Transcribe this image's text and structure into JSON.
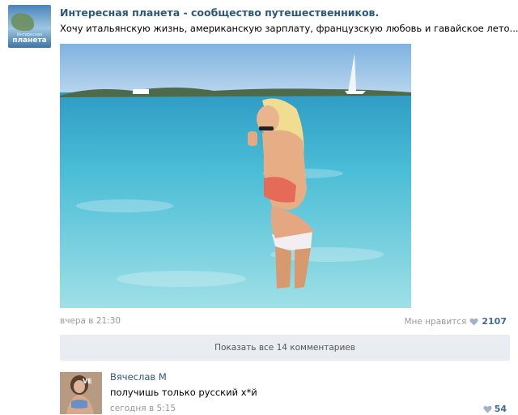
{
  "group": {
    "name": "Интересная планета - сообщество путешественников.",
    "avatar_text": "планета",
    "avatar_small_text": "Интересная"
  },
  "post": {
    "text": "Хочу итальянскую жизнь, американскую зарплату, французскую любовь и гавайское лето...)",
    "date": "вчера в 21:30",
    "like_label": "Мне нравится",
    "like_count": "2107"
  },
  "show_comments_label": "Показать все 14 комментариев",
  "comment": {
    "author": "Вячеслав М",
    "text": "получишь только русский х*й",
    "date": "сегодня в 5:15",
    "like_count": "54",
    "avatar_badge": "VE"
  },
  "colors": {
    "link": "#2b587a",
    "like": "#45688e",
    "muted": "#999999",
    "button_bg": "#e9edf1"
  },
  "icons": {
    "like": "heart-icon"
  }
}
